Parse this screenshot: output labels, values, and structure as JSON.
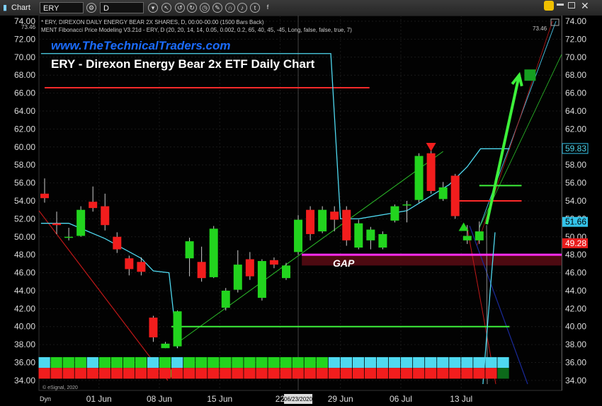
{
  "toolbar": {
    "app_label": "Chart",
    "symbol": "ERY",
    "interval": "D",
    "icons": [
      "gear-icon",
      "cursor-icon",
      "undo-icon",
      "redo-icon",
      "clock-icon",
      "pencil-icon",
      "magnet-icon",
      "bell-icon",
      "twitter-icon",
      "facebook-icon"
    ]
  },
  "header": {
    "line1": "* ERY, DIREXON DAILY ENERGY BEAR 2X SHARES, D, 00:00-00:00 (1500 Bars Back)",
    "line2": "MENT Fibonacci Price Modeling V3.21d - ERY, D (20, 20, 14, 14, 0.05, 0.002, 0.2, 65, 40, 45, -45, Long, false, false, true, 7)",
    "watermark": "www.TheTechnicalTraders.com",
    "title": "ERY - Direxon Energy Bear 2x ETF Daily Chart",
    "gap_label": "GAP",
    "copyright": "© eSignal, 2020",
    "dyn_label": "Dyn",
    "top_left_value": "73.46"
  },
  "colors": {
    "up": "#22d41e",
    "down": "#f21d1d",
    "cyan": "#4fd9f0",
    "magenta": "#ff2cf0",
    "green_line": "#3df03a",
    "red_line": "#ff2a2a",
    "gap_fill": "#5a0c14"
  },
  "chart_data": {
    "type": "candlestick",
    "ylim": [
      33.6,
      74.0
    ],
    "y_ticks": [
      34,
      36,
      38,
      40,
      42,
      44,
      46,
      48,
      50,
      52,
      54,
      56,
      58,
      60,
      62,
      64,
      66,
      68,
      70,
      72,
      74
    ],
    "x_ticks": [
      {
        "label": "01 Jun",
        "bar": 4.5
      },
      {
        "label": "08 Jun",
        "bar": 9.5
      },
      {
        "label": "15 Jun",
        "bar": 14.5
      },
      {
        "label": "22",
        "bar": 19.5
      },
      {
        "label": "29 Jun",
        "bar": 24.5
      },
      {
        "label": "06 Jul",
        "bar": 29.5
      },
      {
        "label": "13 Jul",
        "bar": 34.5
      }
    ],
    "cursor_date_label": "06/23/2020",
    "price_labels": [
      {
        "value": 59.83,
        "text": "59.83"
      },
      {
        "value": 51.66,
        "text": "51.66"
      },
      {
        "value": 49.28,
        "text": "49.28"
      }
    ],
    "candles": [
      {
        "o": 54.8,
        "h": 56.5,
        "l": 53.8,
        "c": 54.3
      },
      {
        "o": 51.5,
        "h": 52.8,
        "l": 50.3,
        "c": 51.3
      },
      {
        "o": 50.0,
        "h": 51.0,
        "l": 49.6,
        "c": 50.0
      },
      {
        "o": 50.1,
        "h": 53.4,
        "l": 50.0,
        "c": 53.0
      },
      {
        "o": 53.9,
        "h": 55.6,
        "l": 52.8,
        "c": 53.2
      },
      {
        "o": 53.4,
        "h": 54.8,
        "l": 50.7,
        "c": 51.3
      },
      {
        "o": 50.0,
        "h": 50.5,
        "l": 48.2,
        "c": 48.6
      },
      {
        "o": 47.6,
        "h": 47.9,
        "l": 45.7,
        "c": 46.4
      },
      {
        "o": 47.2,
        "h": 47.7,
        "l": 45.7,
        "c": 46.1
      },
      {
        "o": 41.0,
        "h": 41.2,
        "l": 38.3,
        "c": 38.8
      },
      {
        "o": 37.6,
        "h": 38.3,
        "l": 37.6,
        "c": 38.1
      },
      {
        "o": 37.8,
        "h": 41.8,
        "l": 37.6,
        "c": 41.7
      },
      {
        "o": 47.6,
        "h": 49.9,
        "l": 45.6,
        "c": 49.5
      },
      {
        "o": 47.2,
        "h": 48.9,
        "l": 45.0,
        "c": 45.4
      },
      {
        "o": 45.5,
        "h": 51.2,
        "l": 45.4,
        "c": 50.9
      },
      {
        "o": 42.1,
        "h": 44.3,
        "l": 41.8,
        "c": 44.0
      },
      {
        "o": 44.1,
        "h": 48.5,
        "l": 43.8,
        "c": 46.9
      },
      {
        "o": 47.5,
        "h": 48.3,
        "l": 45.2,
        "c": 45.6
      },
      {
        "o": 43.2,
        "h": 47.5,
        "l": 42.9,
        "c": 47.3
      },
      {
        "o": 47.4,
        "h": 47.7,
        "l": 46.5,
        "c": 46.9
      },
      {
        "o": 45.4,
        "h": 47.1,
        "l": 45.2,
        "c": 46.8
      },
      {
        "o": 48.3,
        "h": 52.4,
        "l": 48.0,
        "c": 51.9
      },
      {
        "o": 53.0,
        "h": 53.4,
        "l": 49.6,
        "c": 50.3
      },
      {
        "o": 50.6,
        "h": 53.4,
        "l": 50.4,
        "c": 53.0
      },
      {
        "o": 52.8,
        "h": 53.4,
        "l": 50.6,
        "c": 51.9
      },
      {
        "o": 53.0,
        "h": 53.4,
        "l": 49.0,
        "c": 49.6
      },
      {
        "o": 48.8,
        "h": 51.9,
        "l": 48.6,
        "c": 51.5
      },
      {
        "o": 49.6,
        "h": 51.1,
        "l": 48.6,
        "c": 50.8
      },
      {
        "o": 48.8,
        "h": 50.6,
        "l": 48.6,
        "c": 50.3
      },
      {
        "o": 51.8,
        "h": 53.6,
        "l": 51.6,
        "c": 53.4
      },
      {
        "o": 53.6,
        "h": 54.0,
        "l": 51.6,
        "c": 53.6
      },
      {
        "o": 54.1,
        "h": 59.3,
        "l": 53.8,
        "c": 59.0
      },
      {
        "o": 59.3,
        "h": 59.8,
        "l": 54.8,
        "c": 55.1
      },
      {
        "o": 54.2,
        "h": 56.1,
        "l": 54.0,
        "c": 55.5
      },
      {
        "o": 56.8,
        "h": 57.0,
        "l": 52.0,
        "c": 52.3
      },
      {
        "o": 49.6,
        "h": 51.3,
        "l": 49.2,
        "c": 50.1
      },
      {
        "o": 49.6,
        "h": 51.7,
        "l": 49.2,
        "c": 50.6
      }
    ],
    "levels": [
      {
        "color": "red",
        "y": 66.6,
        "x_from": 0,
        "x_to": 26.9
      },
      {
        "color": "green",
        "y": 40.0,
        "x_from": 10.5,
        "x_to": 38.5
      },
      {
        "color": "magenta",
        "y": 48.0,
        "x_from": 21.3,
        "x_to": 43.0
      },
      {
        "color": "green",
        "y": 55.7,
        "x_from": 36.0,
        "x_to": 39.5
      },
      {
        "color": "red",
        "y": 54.0,
        "x_from": 34.2,
        "x_to": 39.5
      }
    ],
    "gap_zone": {
      "y_from": 46.8,
      "y_to": 48.0,
      "x_from": 21.3,
      "x_to": 43.0
    },
    "cyan_stop": [
      {
        "x": -0.3,
        "y": 70.4
      },
      {
        "x": 23.7,
        "y": 70.4
      },
      {
        "x": 24.5,
        "y": 52.0
      },
      {
        "x": 26.0,
        "y": 52.0
      },
      {
        "x": 30.0,
        "y": 52.9
      },
      {
        "x": 33.5,
        "y": 55.8
      },
      {
        "x": 35.0,
        "y": 57.8
      },
      {
        "x": 36.1,
        "y": 59.8
      },
      {
        "x": 38.5,
        "y": 59.8
      }
    ],
    "cyan_stop_early": [
      {
        "x": -0.3,
        "y": 51.5
      },
      {
        "x": 2.0,
        "y": 51.5
      },
      {
        "x": 5.0,
        "y": 49.8
      },
      {
        "x": 8.0,
        "y": 47.6
      },
      {
        "x": 9.0,
        "y": 46.2
      },
      {
        "x": 10.3,
        "y": 46.0
      },
      {
        "x": 11.0,
        "y": 37.6
      }
    ],
    "arrow": {
      "from": {
        "x": 36.6,
        "y": 51.4
      },
      "to": {
        "x": 39.3,
        "y": 68.0
      }
    },
    "target_box": {
      "x": 40.2,
      "y": 68.0
    },
    "signal_strip": {
      "top_colors": [
        "cyan",
        "up",
        "up",
        "up",
        "cyan",
        "up",
        "up",
        "up",
        "up",
        "cyan",
        "up",
        "cyan",
        "up",
        "up",
        "up",
        "up",
        "up",
        "up",
        "up",
        "up",
        "up",
        "up",
        "up",
        "up",
        "cyan",
        "cyan",
        "cyan",
        "cyan",
        "cyan",
        "cyan",
        "cyan",
        "cyan",
        "cyan",
        "cyan",
        "cyan",
        "cyan",
        "cyan",
        "cyan",
        "cyan"
      ],
      "bottom_colors": [
        "down",
        "down",
        "down",
        "down",
        "down",
        "down",
        "down",
        "down",
        "down",
        "down",
        "down",
        "down",
        "down",
        "down",
        "down",
        "down",
        "down",
        "down",
        "down",
        "down",
        "down",
        "down",
        "down",
        "down",
        "down",
        "down",
        "down",
        "down",
        "down",
        "down",
        "down",
        "down",
        "down",
        "down",
        "down",
        "down",
        "down",
        "down",
        "green_dark"
      ]
    }
  }
}
